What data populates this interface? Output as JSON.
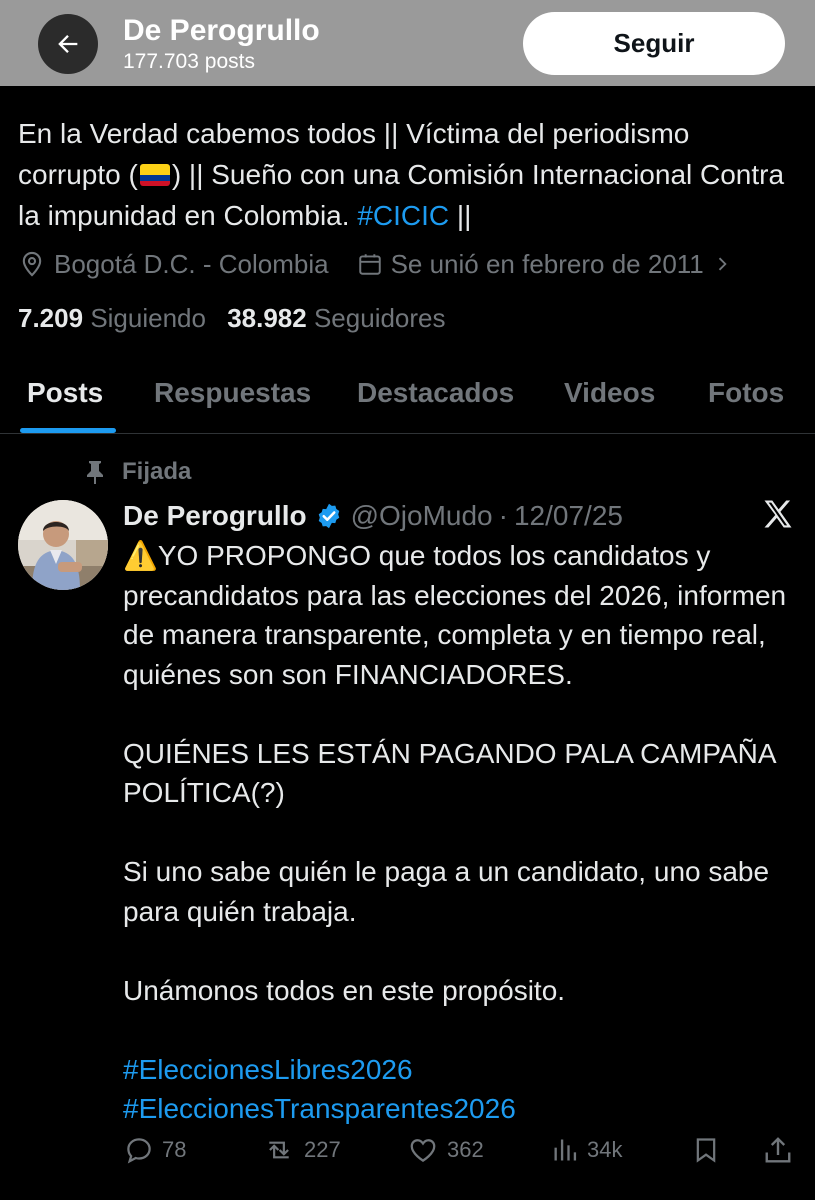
{
  "header": {
    "name": "De Perogrullo",
    "post_count": "177.703",
    "post_label": "posts",
    "follow_label": "Seguir"
  },
  "bio": {
    "part1": "En la Verdad cabemos todos || Víctima del periodismo corrupto (",
    "part2": ") || Sueño con una Comisión Internacional Contra la impunidad en Colombia. ",
    "hashtag": "#CICIC",
    "part3": " ||",
    "flag_colors": [
      "#fcd116",
      "#003893",
      "#ce1126"
    ]
  },
  "meta": {
    "location": "Bogotá D.C. - Colombia",
    "joined": "Se unió en febrero de 2011"
  },
  "counts": {
    "following": "7.209",
    "following_label": "Siguiendo",
    "followers": "38.982",
    "followers_label": "Seguidores"
  },
  "tabs": [
    {
      "label": "Posts",
      "active": true
    },
    {
      "label": "Respuestas"
    },
    {
      "label": "Destacados"
    },
    {
      "label": "Videos"
    },
    {
      "label": "Fotos"
    }
  ],
  "post": {
    "pinned_label": "Fijada",
    "author": "De Perogrullo",
    "handle": "@OjoMudo",
    "separator": "·",
    "date": "12/07/25",
    "line1": "⚠️YO PROPONGO que todos los candidatos y precandidatos para las elecciones del 2026, informen de manera transparente, completa y en tiempo real, quiénes son son FINANCIADORES.",
    "line2": "QUIÉNES LES ESTÁN PAGANDO PALA CAMPAÑA POLÍTICA(?)",
    "line3": "Si uno sabe quién le paga a un candidato, uno sabe para quién trabaja.",
    "line4": "Unámonos todos en este propósito.",
    "hashtag1": "#EleccionesLibres2026",
    "hashtag2": "#EleccionesTransparentes2026",
    "replies": "78",
    "reposts": "227",
    "likes": "362",
    "views": "34k"
  },
  "colors": {
    "accent": "#1d9bf0",
    "muted": "#71767b",
    "text": "#e7e9ea",
    "background": "#000000",
    "verified": "#1d9bf0"
  }
}
